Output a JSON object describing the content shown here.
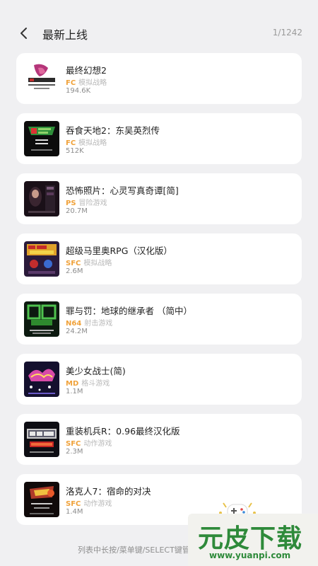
{
  "header": {
    "title": "最新上线",
    "counter": "1/1242"
  },
  "games": [
    {
      "name": "最终幻想2",
      "platform": "FC",
      "genre": "模拟战略",
      "size": "194.6K"
    },
    {
      "name": "吞食天地2：东吴英烈传",
      "platform": "FC",
      "genre": "模拟战略",
      "size": "512K"
    },
    {
      "name": "恐怖照片：心灵写真奇谭[简]",
      "platform": "PS",
      "genre": "冒险游戏",
      "size": "20.7M"
    },
    {
      "name": "超级马里奥RPG（汉化版）",
      "platform": "SFC",
      "genre": "模拟战略",
      "size": "2.6M"
    },
    {
      "name": "罪与罚：地球的继承者 （简中）",
      "platform": "N64",
      "genre": "射击游戏",
      "size": "24.2M"
    },
    {
      "name": "美少女战士(简)",
      "platform": "MD",
      "genre": "格斗游戏",
      "size": "1.1M"
    },
    {
      "name": "重装机兵R：0.96最终汉化版",
      "platform": "SFC",
      "genre": "动作游戏",
      "size": "2.3M"
    },
    {
      "name": "洛克人7：宿命的对决",
      "platform": "SFC",
      "genre": "动作游戏",
      "size": "1.4M"
    }
  ],
  "footer": {
    "hint": "列表中长按/菜单键/SELECT键管"
  },
  "watermark": {
    "logo": "元皮下载",
    "url": "www.yuanpi.com"
  },
  "colors": {
    "platform": "#f0a23a",
    "background": "#f0f0f2",
    "card": "#ffffff"
  }
}
